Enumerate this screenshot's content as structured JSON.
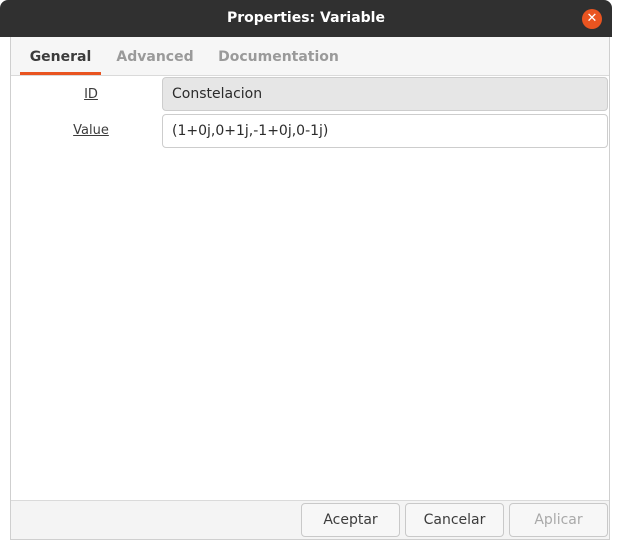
{
  "window": {
    "title": "Properties: Variable",
    "close_icon": "close-icon",
    "accent_color": "#e95420"
  },
  "tabs": [
    {
      "label": "General",
      "active": true
    },
    {
      "label": "Advanced",
      "active": false
    },
    {
      "label": "Documentation",
      "active": false
    }
  ],
  "fields": {
    "id": {
      "label": "ID",
      "value": "Constelacion"
    },
    "value": {
      "label": "Value",
      "value": "(1+0j,0+1j,-1+0j,0-1j)"
    }
  },
  "buttons": {
    "accept": "Aceptar",
    "cancel": "Cancelar",
    "apply": "Aplicar"
  }
}
